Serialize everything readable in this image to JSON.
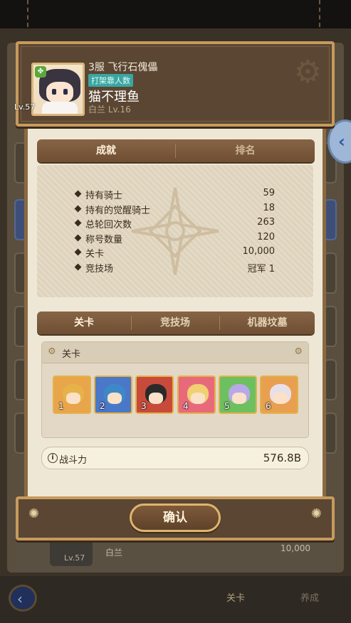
{
  "profile": {
    "title": "3服 飞行石傀儡",
    "tag": "打架靠人数",
    "name": "猫不理鱼",
    "guild": "白兰 Lv.16",
    "level": "Lv.57"
  },
  "tabs_top": [
    "成就",
    "排名"
  ],
  "stats": [
    {
      "label": "持有骑士",
      "value": "59"
    },
    {
      "label": "持有的觉醒骑士",
      "value": "18"
    },
    {
      "label": "总轮回次数",
      "value": "263"
    },
    {
      "label": "称号数量",
      "value": "120"
    },
    {
      "label": "关卡",
      "value": "10,000"
    },
    {
      "label": "竞技场",
      "value": "冠军 1"
    }
  ],
  "tabs_mode": [
    "关卡",
    "竞技场",
    "机器坟墓"
  ],
  "lineup": {
    "title": "关卡",
    "heroes": [
      {
        "slot": "1",
        "hair": "#e6b24a",
        "bg": "#e9a54a"
      },
      {
        "slot": "2",
        "hair": "#3f88c8",
        "bg": "#4a78c8"
      },
      {
        "slot": "3",
        "hair": "#2a2a2a",
        "bg": "#c84a3a"
      },
      {
        "slot": "4",
        "hair": "#f0d070",
        "bg": "#e86a7a"
      },
      {
        "slot": "5",
        "hair": "#b8a8e8",
        "bg": "#6cc060"
      },
      {
        "slot": "6",
        "hair": "#e8e0e8",
        "bg": "#e8a050"
      }
    ]
  },
  "power": {
    "label": "战斗力",
    "value": "576.8B",
    "info_icon": "i"
  },
  "confirm_label": "确认",
  "background": {
    "level": "Lv.57",
    "name": "白兰",
    "value": "10,000",
    "nav_tab1": "关卡",
    "nav_tab2": "养成"
  }
}
